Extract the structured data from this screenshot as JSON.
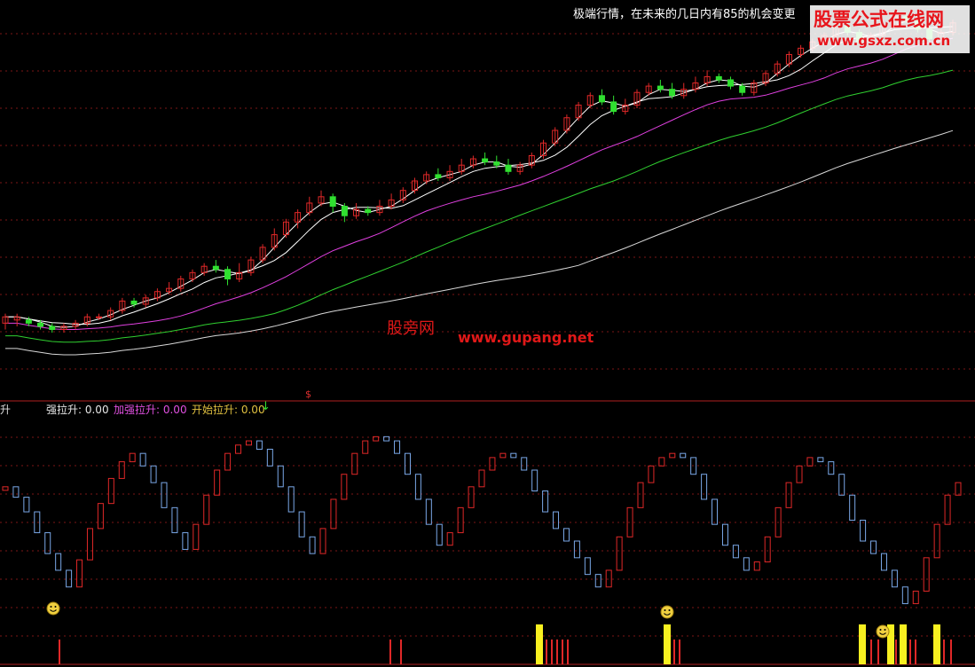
{
  "notice": "极端行情，在未来的几日内有85的机会变更",
  "watermark_top": {
    "name": "股票公式在线网",
    "url": "www.gsxz.com.cn"
  },
  "watermark_center": {
    "name": "股旁网",
    "url": "www.gupang.net"
  },
  "indicator_legend": {
    "left_cut": "升",
    "strong": "强拉升: 0.00",
    "enhanced": "加强拉升: 0.00",
    "start": "开始拉升: 0.00",
    "arrow": "↓"
  },
  "marker_s": "$",
  "colors": {
    "background": "#000000",
    "up_candle": "#e02828",
    "down_candle": "#30e030",
    "ma_short": "#ffffff",
    "ma_mid": "#e040e0",
    "ma_long": "#30d030",
    "ma_longest": "#d8d8d8",
    "osc_up": "#e02828",
    "osc_down": "#7aa8e8",
    "signal_yellow": "#f8f020",
    "grid": "#b02020"
  },
  "chart_data": [
    {
      "type": "candlestick",
      "title": "",
      "candles": [
        [
          10,
          12,
          8,
          13
        ],
        [
          11,
          12,
          9,
          13
        ],
        [
          11,
          10,
          9,
          12
        ],
        [
          10,
          9,
          8,
          11
        ],
        [
          9,
          8,
          7,
          10
        ],
        [
          8,
          9,
          7,
          10
        ],
        [
          9,
          10,
          8,
          11
        ],
        [
          10,
          12,
          9,
          13
        ],
        [
          12,
          12,
          11,
          13
        ],
        [
          12,
          14,
          11,
          15
        ],
        [
          14,
          17,
          13,
          18
        ],
        [
          17,
          16,
          15,
          18
        ],
        [
          16,
          18,
          15,
          19
        ],
        [
          18,
          20,
          17,
          21
        ],
        [
          20,
          21,
          19,
          23
        ],
        [
          21,
          24,
          20,
          25
        ],
        [
          24,
          26,
          23,
          27
        ],
        [
          26,
          28,
          25,
          29
        ],
        [
          28,
          27,
          26,
          30
        ],
        [
          27,
          24,
          22,
          28
        ],
        [
          24,
          26,
          23,
          29
        ],
        [
          26,
          30,
          25,
          31
        ],
        [
          30,
          34,
          29,
          35
        ],
        [
          34,
          38,
          33,
          40
        ],
        [
          38,
          42,
          37,
          43
        ],
        [
          42,
          45,
          40,
          46
        ],
        [
          45,
          48,
          44,
          50
        ],
        [
          48,
          50,
          47,
          52
        ],
        [
          50,
          47,
          45,
          51
        ],
        [
          47,
          44,
          42,
          48
        ],
        [
          44,
          46,
          43,
          48
        ],
        [
          46,
          45,
          44,
          47
        ],
        [
          45,
          47,
          44,
          49
        ],
        [
          47,
          49,
          46,
          51
        ],
        [
          49,
          52,
          48,
          53
        ],
        [
          52,
          55,
          51,
          56
        ],
        [
          55,
          57,
          54,
          58
        ],
        [
          57,
          56,
          55,
          59
        ],
        [
          56,
          58,
          55,
          60
        ],
        [
          58,
          60,
          57,
          62
        ],
        [
          60,
          62,
          59,
          63
        ],
        [
          62,
          61,
          60,
          64
        ],
        [
          61,
          60,
          59,
          63
        ],
        [
          60,
          58,
          57,
          62
        ],
        [
          58,
          60,
          57,
          61
        ],
        [
          60,
          63,
          59,
          64
        ],
        [
          63,
          67,
          62,
          68
        ],
        [
          67,
          71,
          66,
          72
        ],
        [
          71,
          75,
          70,
          76
        ],
        [
          75,
          79,
          74,
          80
        ],
        [
          79,
          82,
          78,
          83
        ],
        [
          82,
          80,
          79,
          84
        ],
        [
          80,
          77,
          76,
          82
        ],
        [
          77,
          79,
          76,
          81
        ],
        [
          79,
          83,
          78,
          84
        ],
        [
          83,
          85,
          82,
          86
        ],
        [
          85,
          84,
          83,
          87
        ],
        [
          84,
          82,
          81,
          86
        ],
        [
          82,
          84,
          81,
          86
        ],
        [
          84,
          86,
          83,
          88
        ],
        [
          86,
          88,
          85,
          90
        ],
        [
          88,
          87,
          86,
          89
        ],
        [
          87,
          85,
          84,
          88
        ],
        [
          85,
          83,
          82,
          86
        ],
        [
          83,
          86,
          82,
          87
        ],
        [
          86,
          89,
          85,
          90
        ],
        [
          89,
          92,
          88,
          93
        ],
        [
          92,
          95,
          91,
          96
        ],
        [
          95,
          97,
          94,
          98
        ],
        [
          97,
          99,
          96,
          100
        ],
        [
          99,
          101,
          98,
          102
        ],
        [
          101,
          104,
          100,
          105
        ],
        [
          104,
          102,
          101,
          106
        ],
        [
          102,
          99,
          98,
          103
        ],
        [
          99,
          101,
          98,
          102
        ],
        [
          101,
          104,
          100,
          106
        ],
        [
          104,
          107,
          103,
          108
        ],
        [
          107,
          106,
          105,
          108
        ],
        [
          106,
          103,
          102,
          107
        ],
        [
          103,
          100,
          99,
          104
        ],
        [
          100,
          102,
          99,
          103
        ],
        [
          102,
          105,
          101,
          106
        ]
      ],
      "ma_periods": [
        "MA5",
        "MA10",
        "MA30",
        "MA120"
      ]
    },
    {
      "type": "bar",
      "title": "",
      "series": [
        {
          "name": "强拉升",
          "values": [
            0.0
          ]
        },
        {
          "name": "加强拉升",
          "values": [
            0.0
          ]
        },
        {
          "name": "开始拉升",
          "values": [
            0.0
          ]
        }
      ],
      "oscillator": [
        70,
        65,
        58,
        48,
        38,
        30,
        22,
        35,
        50,
        62,
        74,
        82,
        86,
        80,
        72,
        60,
        48,
        40,
        52,
        66,
        78,
        86,
        90,
        92,
        88,
        80,
        70,
        58,
        46,
        38,
        50,
        64,
        76,
        86,
        92,
        94,
        92,
        86,
        76,
        64,
        52,
        42,
        48,
        60,
        70,
        78,
        84,
        86,
        84,
        78,
        68,
        58,
        50,
        44,
        36,
        28,
        22,
        30,
        46,
        60,
        72,
        80,
        84,
        86,
        84,
        76,
        64,
        52,
        42,
        36,
        30,
        34,
        46,
        60,
        72,
        80,
        84,
        82,
        76,
        66,
        54,
        44,
        38,
        30,
        22,
        14,
        20,
        36,
        52,
        66,
        72
      ]
    }
  ]
}
